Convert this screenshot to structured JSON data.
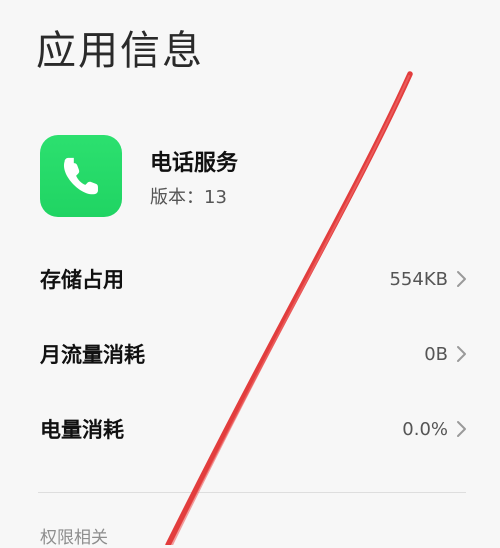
{
  "page": {
    "title": "应用信息"
  },
  "app": {
    "name": "电话服务",
    "version": "版本：13",
    "icon": "phone-icon"
  },
  "rows": [
    {
      "label": "存储占用",
      "value": "554KB"
    },
    {
      "label": "月流量消耗",
      "value": "0B"
    },
    {
      "label": "电量消耗",
      "value": "0.0%"
    }
  ],
  "section": {
    "title": "权限相关"
  },
  "colors": {
    "background": "#f7f7f7",
    "icon_green": "#22d765",
    "text_primary": "#111111",
    "text_secondary": "#555555",
    "section_text": "#8e8e8e",
    "overlay_red": "#e23d3d"
  }
}
